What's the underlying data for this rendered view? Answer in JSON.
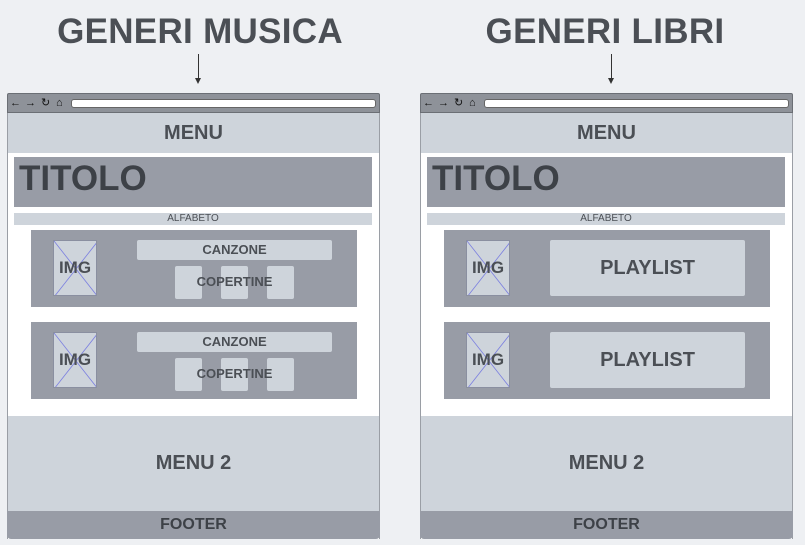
{
  "panels": [
    {
      "heading": "GENERI MUSICA",
      "browser_icons": [
        "arrow-left-icon",
        "arrow-right-icon",
        "reload-icon",
        "home-icon"
      ],
      "menu": "MENU",
      "title": "TITOLO",
      "alphabet": "ALFABETO",
      "cards": [
        {
          "img": "IMG",
          "song": "CANZONE",
          "covers": "COPERTINE"
        },
        {
          "img": "IMG",
          "song": "CANZONE",
          "covers": "COPERTINE"
        }
      ],
      "menu2": "MENU 2",
      "footer": "FOOTER"
    },
    {
      "heading": "GENERI LIBRI",
      "browser_icons": [
        "arrow-left-icon",
        "arrow-right-icon",
        "reload-icon",
        "home-icon"
      ],
      "menu": "MENU",
      "title": "TITOLO",
      "alphabet": "ALFABETO",
      "cards": [
        {
          "img": "IMG",
          "playlist": "PLAYLIST"
        },
        {
          "img": "IMG",
          "playlist": "PLAYLIST"
        }
      ],
      "menu2": "MENU 2",
      "footer": "FOOTER"
    }
  ],
  "colors": {
    "background": "#eef0f3",
    "dark_block": "#989ca6",
    "light_block": "#ced4db",
    "text": "#4b4f55",
    "placeholder_cross": "#7b7fe0"
  }
}
